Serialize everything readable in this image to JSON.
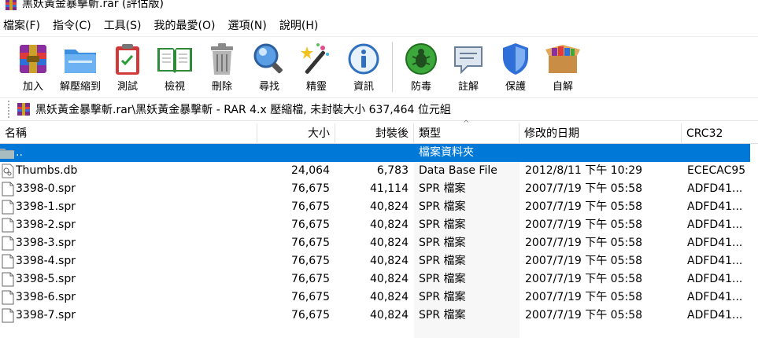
{
  "window": {
    "title": "黑妖黃金暴擊斬.rar (評估版)"
  },
  "menu": [
    "檔案(F)",
    "指令(C)",
    "工具(S)",
    "我的最愛(O)",
    "選項(N)",
    "說明(H)"
  ],
  "toolbar": {
    "buttons": [
      {
        "label": "加入",
        "icon": "add-archive-icon"
      },
      {
        "label": "解壓縮到",
        "icon": "extract-to-icon"
      },
      {
        "label": "測試",
        "icon": "test-clipboard-icon"
      },
      {
        "label": "檢視",
        "icon": "view-book-icon"
      },
      {
        "label": "刪除",
        "icon": "trash-icon"
      },
      {
        "label": "尋找",
        "icon": "magnifier-icon"
      },
      {
        "label": "精靈",
        "icon": "wizard-wand-icon"
      },
      {
        "label": "資訊",
        "icon": "info-icon"
      },
      {
        "label": "防毒",
        "icon": "virus-scan-icon"
      },
      {
        "label": "註解",
        "icon": "comment-icon"
      },
      {
        "label": "保護",
        "icon": "shield-icon"
      },
      {
        "label": "自解",
        "icon": "sfx-box-icon"
      }
    ]
  },
  "address": {
    "path": "黑妖黃金暴擊斬.rar\\黑妖黃金暴擊斬 - RAR 4.x 壓縮檔, 未封裝大小 637,464 位元組"
  },
  "list": {
    "headers": {
      "name": "名稱",
      "size": "大小",
      "packed": "封裝後",
      "type": "類型",
      "modified": "修改的日期",
      "crc": "CRC32"
    },
    "sort_indicator": "^",
    "parent": {
      "name": "..",
      "type": "檔案資料夾"
    },
    "rows": [
      {
        "name": "Thumbs.db",
        "size": "24,064",
        "packed": "6,783",
        "type": "Data Base File",
        "modified": "2012/8/11 下午 10:29",
        "crc": "ECECAC95"
      },
      {
        "name": "3398-0.spr",
        "size": "76,675",
        "packed": "41,114",
        "type": "SPR 檔案",
        "modified": "2007/7/19 下午 05:58",
        "crc": "ADFD41..."
      },
      {
        "name": "3398-1.spr",
        "size": "76,675",
        "packed": "40,824",
        "type": "SPR 檔案",
        "modified": "2007/7/19 下午 05:58",
        "crc": "ADFD41..."
      },
      {
        "name": "3398-2.spr",
        "size": "76,675",
        "packed": "40,824",
        "type": "SPR 檔案",
        "modified": "2007/7/19 下午 05:58",
        "crc": "ADFD41..."
      },
      {
        "name": "3398-3.spr",
        "size": "76,675",
        "packed": "40,824",
        "type": "SPR 檔案",
        "modified": "2007/7/19 下午 05:58",
        "crc": "ADFD41..."
      },
      {
        "name": "3398-4.spr",
        "size": "76,675",
        "packed": "40,824",
        "type": "SPR 檔案",
        "modified": "2007/7/19 下午 05:58",
        "crc": "ADFD41..."
      },
      {
        "name": "3398-5.spr",
        "size": "76,675",
        "packed": "40,824",
        "type": "SPR 檔案",
        "modified": "2007/7/19 下午 05:58",
        "crc": "ADFD41..."
      },
      {
        "name": "3398-6.spr",
        "size": "76,675",
        "packed": "40,824",
        "type": "SPR 檔案",
        "modified": "2007/7/19 下午 05:58",
        "crc": "ADFD41..."
      },
      {
        "name": "3398-7.spr",
        "size": "76,675",
        "packed": "40,824",
        "type": "SPR 檔案",
        "modified": "2007/7/19 下午 05:58",
        "crc": "ADFD41..."
      }
    ]
  },
  "colors": {
    "selection": "#0078d7",
    "type_column_bg": "#f7f7f7"
  }
}
